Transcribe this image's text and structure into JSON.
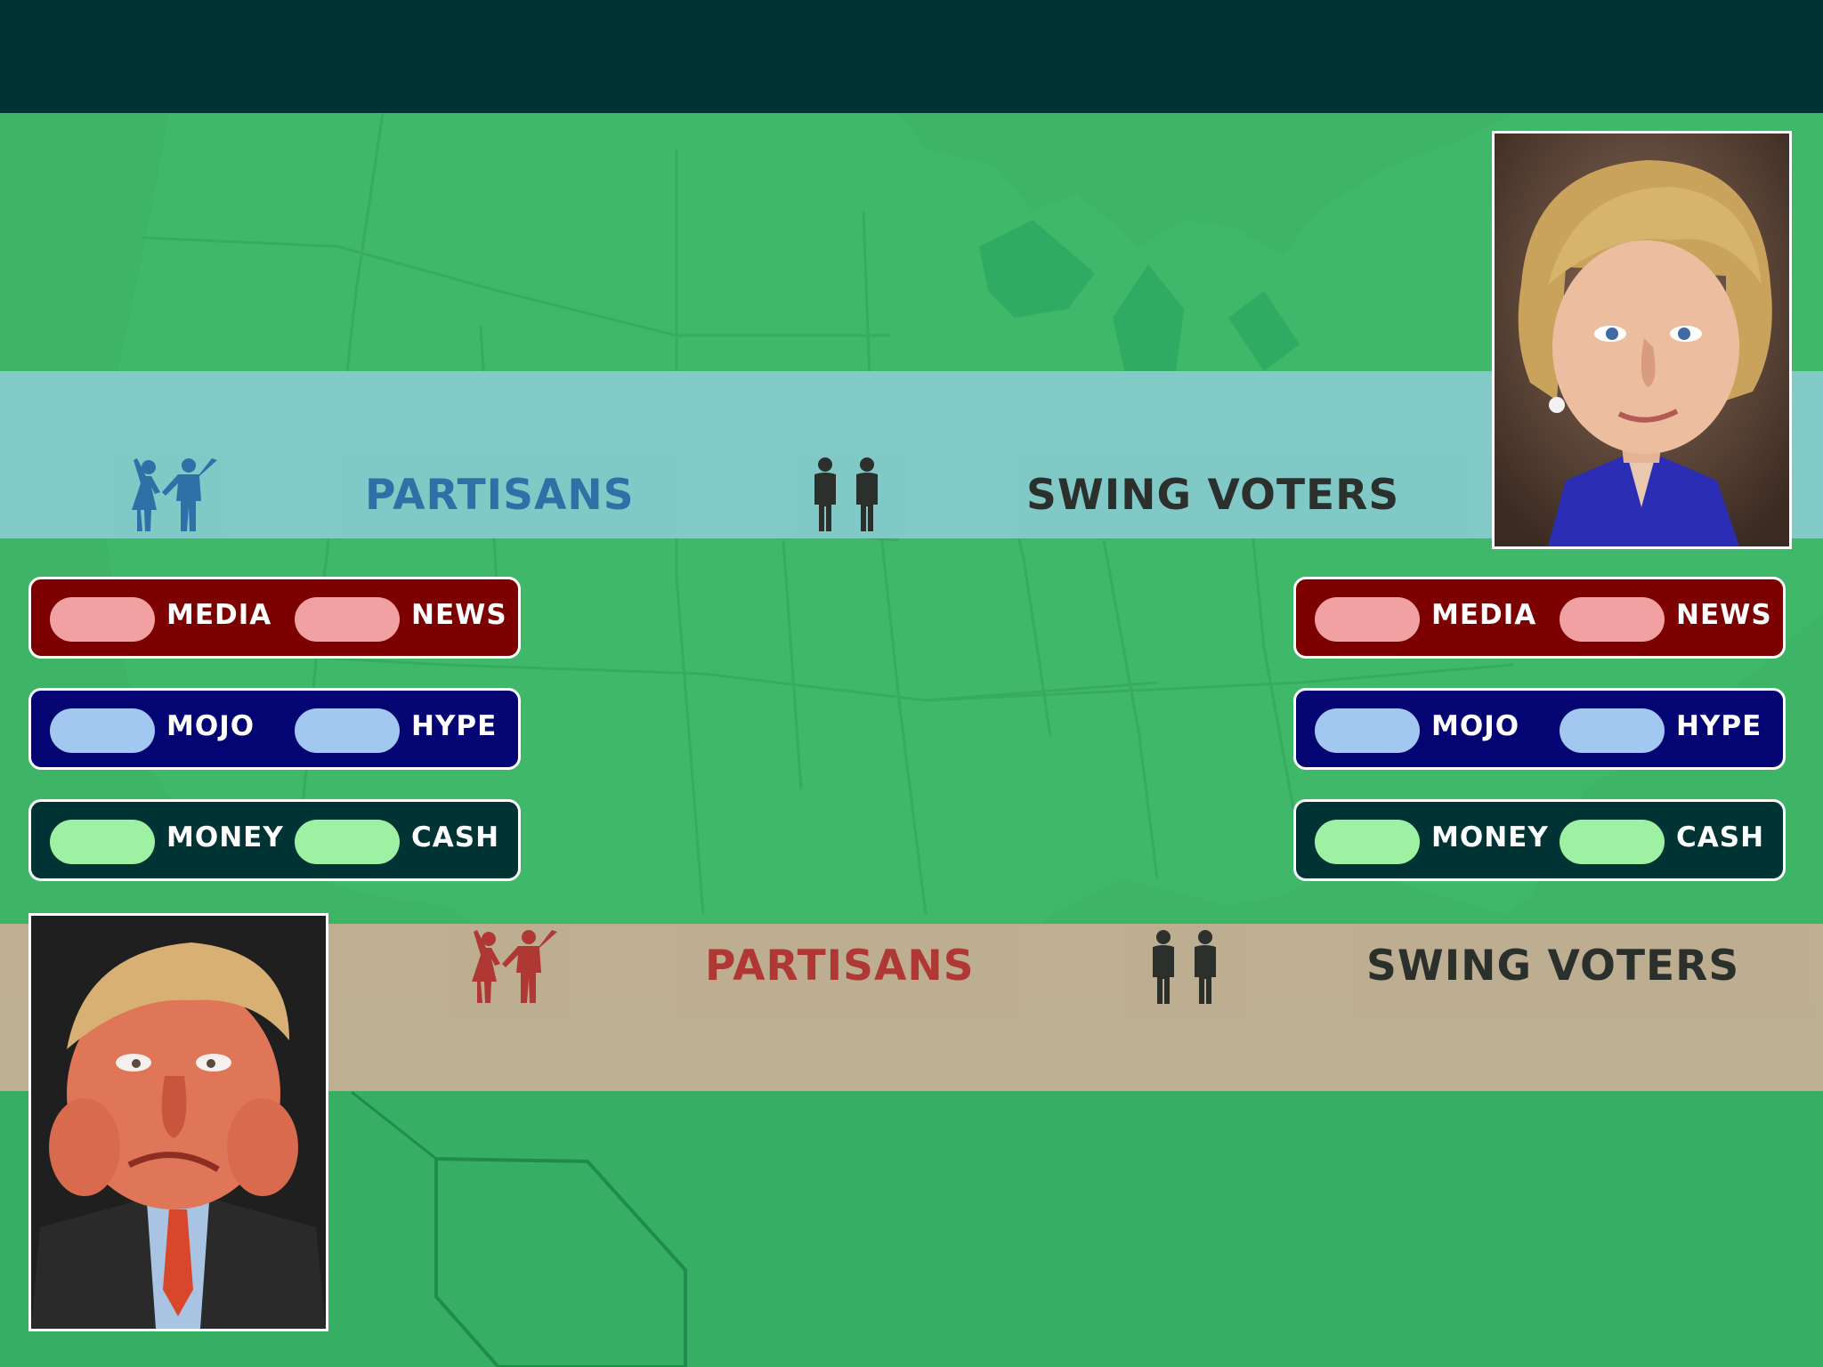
{
  "colors": {
    "topbar": "#003334",
    "background": "#3db466",
    "blue_band": "#84cacb",
    "tan_band": "#c2ae94",
    "partisans_blue": "#2d6faa",
    "partisans_red": "#b33434",
    "swing_dark": "#2c2c2c",
    "media_panel": "#7c0000",
    "media_pill": "#f2a1a3",
    "mojo_panel": "#040472",
    "mojo_pill": "#a2c7f0",
    "money_panel": "#003334",
    "money_pill": "#9ef1a3"
  },
  "top_band": {
    "partisans_label": "PARTISANS",
    "swing_label": "SWING VOTERS",
    "partisans_icon": "cheering-couple-icon",
    "swing_icon": "standing-pair-icon"
  },
  "bottom_band": {
    "partisans_label": "PARTISANS",
    "swing_label": "SWING VOTERS",
    "partisans_icon": "cheering-couple-icon",
    "swing_icon": "standing-pair-icon"
  },
  "left_panels": [
    {
      "name": "media-panel",
      "left_label": "MEDIA",
      "right_label": "NEWS"
    },
    {
      "name": "mojo-panel",
      "left_label": "MOJO",
      "right_label": "HYPE"
    },
    {
      "name": "money-panel",
      "left_label": "MONEY",
      "right_label": "CASH"
    }
  ],
  "right_panels": [
    {
      "name": "media-panel",
      "left_label": "MEDIA",
      "right_label": "NEWS"
    },
    {
      "name": "mojo-panel",
      "left_label": "MOJO",
      "right_label": "HYPE"
    },
    {
      "name": "money-panel",
      "left_label": "MONEY",
      "right_label": "CASH"
    }
  ],
  "portraits": {
    "top_right": "caricature-portrait-woman",
    "bottom_left": "caricature-portrait-man"
  }
}
